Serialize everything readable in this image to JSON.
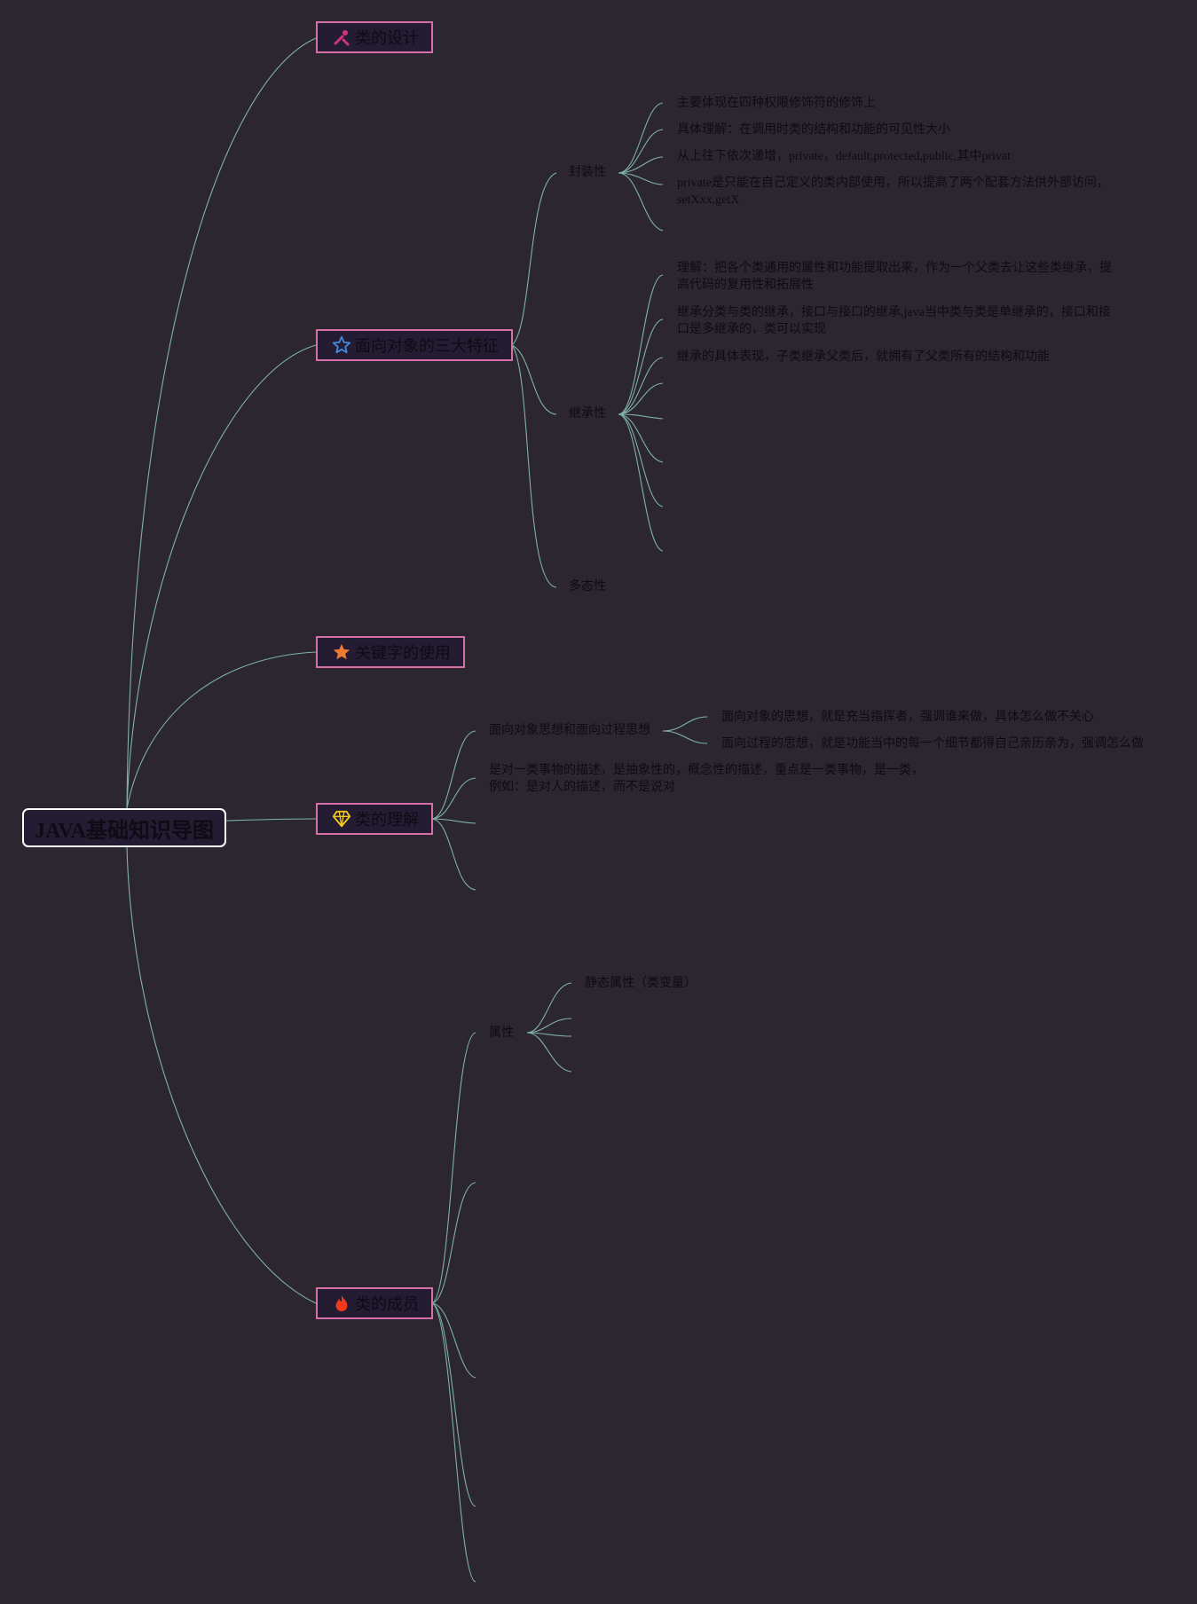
{
  "root": {
    "title": "JAVA基础知识导图"
  },
  "topics": {
    "design": {
      "label": "类的设计",
      "icon": "tools-icon",
      "color": "#d0347a"
    },
    "oop": {
      "label": "面向对象的三大特征",
      "icon": "star-outline-icon",
      "color": "#3f8ae0"
    },
    "keyword": {
      "label": "关键字的使用",
      "icon": "star-filled-icon",
      "color": "#ef7a32"
    },
    "understand": {
      "label": "类的理解",
      "icon": "diamond-icon",
      "color": "#f4c91d"
    },
    "member": {
      "label": "类的成员",
      "icon": "fire-icon",
      "color": "#ef3a1c"
    }
  },
  "encapsulation": {
    "label": "封装性",
    "items": [
      "主要体现在四种权限修饰符的修饰上",
      "具体理解：在调用时类的结构和功能的可见性大小",
      "从上往下依次递增，private，default,protected,public,其中privat",
      "private是只能在自己定义的类内部使用，所以提高了两个配套方法供外部访问，setXxx,getX"
    ]
  },
  "inheritance": {
    "label": "继承性",
    "items": [
      "理解：把各个类通用的属性和功能提取出来，作为一个父类去让这些类继承，提高代码的复用性和拓展性",
      "继承分类与类的继承，接口与接口的继承,java当中类与类是单继承的，接口和接口是多继承的，类可以实现",
      "继承的具体表现，子类继承父类后，就拥有了父类所有的结构和功能"
    ]
  },
  "polymorphism": {
    "label": "多态性"
  },
  "understanding": {
    "thought": {
      "label": "面向对象思想和面向过程思想",
      "items": [
        "面向对象的思想，就是充当指挥者，强调谁来做，具体怎么做不关心",
        "面向过程的思想，就是功能当中的每一个细节都得自己亲历亲为，强调怎么做"
      ]
    },
    "desc": "是对一类事物的描述，是抽象性的，概念性的描述，重点是一类事物，是一类，例如：是对人的描述，而不是说对"
  },
  "members": {
    "attr": {
      "label": "属性",
      "items": [
        "静态属性（类变量）"
      ]
    }
  }
}
